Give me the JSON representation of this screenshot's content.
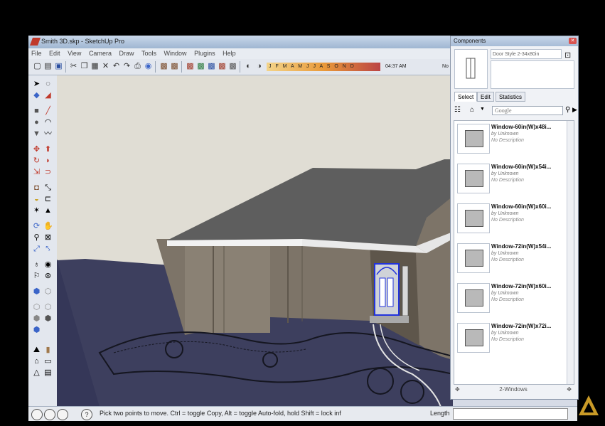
{
  "window": {
    "title": "Smith 3D.skp - SketchUp Pro"
  },
  "menu": [
    "File",
    "Edit",
    "View",
    "Camera",
    "Draw",
    "Tools",
    "Window",
    "Plugins",
    "Help"
  ],
  "toolbar": {
    "months": "J F M A M J J A S O N D",
    "time": "04:37 AM",
    "extra": "No"
  },
  "statusbar": {
    "message": "Pick two points to move.  Ctrl = toggle Copy, Alt = toggle Auto-fold, hold Shift = lock inf",
    "help_symbol": "?",
    "length_label": "Length"
  },
  "components": {
    "title": "Components",
    "name_value": "Door Style 2-34x80in",
    "tabs": [
      "Select",
      "Edit",
      "Statistics"
    ],
    "search_placeholder": "Google",
    "items": [
      {
        "name": "Window-60in(W)x48i...",
        "by": "by Unknown",
        "desc": "No Description"
      },
      {
        "name": "Window-60in(W)x54i...",
        "by": "by Unknown",
        "desc": "No Description"
      },
      {
        "name": "Window-60in(W)x60i...",
        "by": "by Unknown",
        "desc": "No Description"
      },
      {
        "name": "Window-72in(W)x54i...",
        "by": "by Unknown",
        "desc": "No Description"
      },
      {
        "name": "Window-72in(W)x60i...",
        "by": "by Unknown",
        "desc": "No Description"
      },
      {
        "name": "Window-72in(W)x72i...",
        "by": "by Unknown",
        "desc": "No Description"
      }
    ],
    "footer": "2-Windows"
  },
  "colors": {
    "roof": "#5e5e5e",
    "brick": "#7d7468",
    "ground": "#3d3f5e",
    "sky": "#e0ddd4",
    "selection": "#2233dd"
  }
}
